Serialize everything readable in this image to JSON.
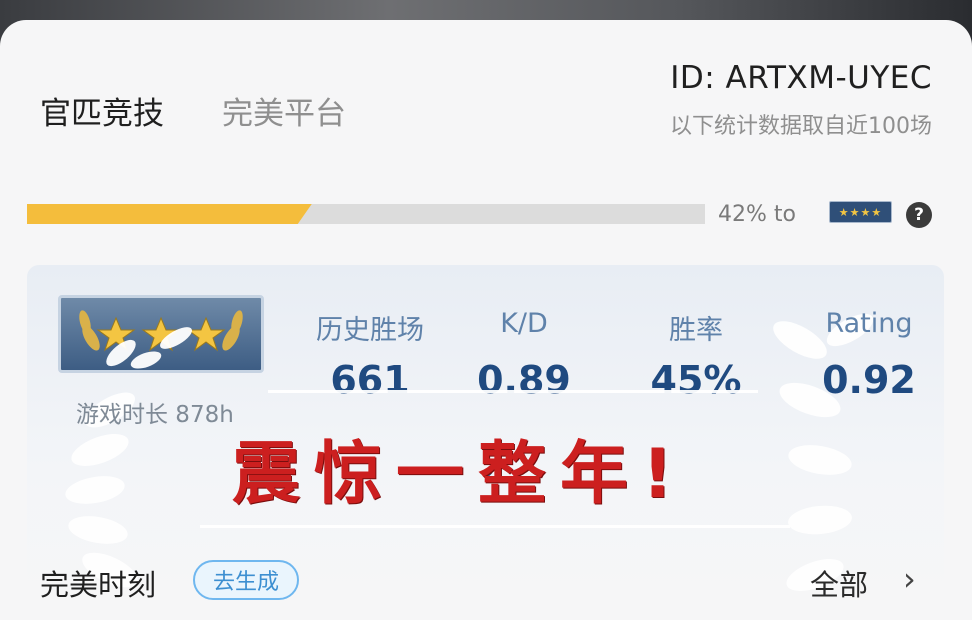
{
  "header": {
    "tabs": [
      {
        "label": "官匹竞技",
        "active": true
      },
      {
        "label": "完美平台",
        "active": false
      }
    ],
    "user_id": "ID: ARTXM-UYEC",
    "stat_note": "以下统计数据取自近100场"
  },
  "progress": {
    "fraction": 0.42,
    "text": "42% to",
    "next_rank_label": "★★★★",
    "help_glyph": "?"
  },
  "profile": {
    "rank_icon": "gold-nova-wreath-badge",
    "playtime": "游戏时长 878h"
  },
  "stats": [
    {
      "label": "历史胜场",
      "value": "661"
    },
    {
      "label": "K/D",
      "value": "0.89"
    },
    {
      "label": "胜率",
      "value": "45%"
    },
    {
      "label": "Rating",
      "value": "0.92"
    }
  ],
  "overlay": {
    "caption": "震惊一整年!",
    "chevron": "⌄"
  },
  "moments": {
    "title": "完美时刻",
    "generate_label": "去生成",
    "all_label": "全部",
    "all_chevron": "›"
  },
  "colors": {
    "progress_fill": "#f4bd3c",
    "stat_value": "#1f4a80",
    "caption": "#cc1f1f",
    "chip": "#3d8fd1"
  }
}
